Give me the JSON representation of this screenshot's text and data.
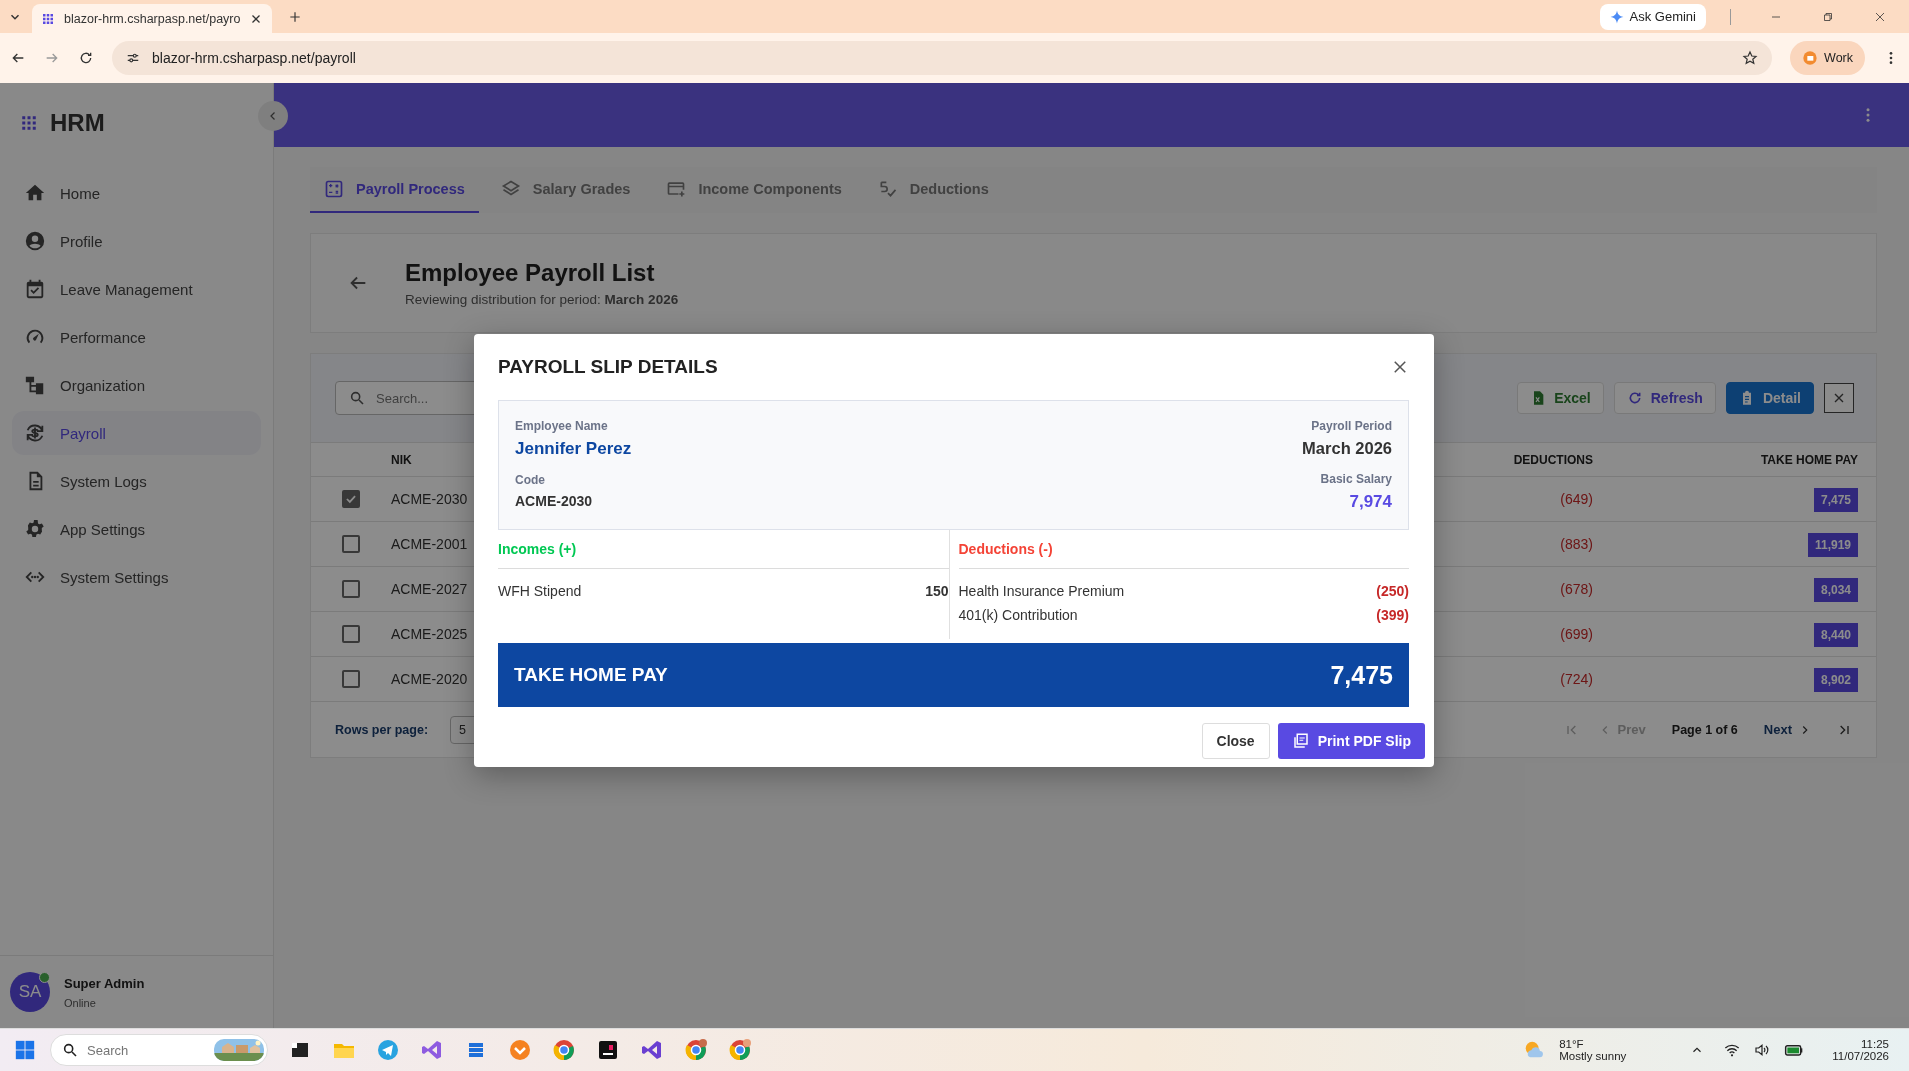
{
  "browser": {
    "tab_title": "blazor-hrm.csharpasp.net/payro",
    "url": "blazor-hrm.csharpasp.net/payroll",
    "gemini": "Ask Gemini",
    "profile": "Work"
  },
  "app": {
    "brand": "HRM"
  },
  "sidebar": {
    "items": [
      {
        "label": "Home",
        "selected": false
      },
      {
        "label": "Profile",
        "selected": false
      },
      {
        "label": "Leave Management",
        "selected": false
      },
      {
        "label": "Performance",
        "selected": false
      },
      {
        "label": "Organization",
        "selected": false
      },
      {
        "label": "Payroll",
        "selected": true
      },
      {
        "label": "System Logs",
        "selected": false
      },
      {
        "label": "App Settings",
        "selected": false
      },
      {
        "label": "System Settings",
        "selected": false
      }
    ],
    "user": {
      "initials": "SA",
      "name": "Super Admin",
      "status": "Online",
      "online": true
    }
  },
  "tabs": [
    {
      "label": "Payroll Process",
      "selected": true
    },
    {
      "label": "Salary Grades",
      "selected": false
    },
    {
      "label": "Income Components",
      "selected": false
    },
    {
      "label": "Deductions",
      "selected": false
    }
  ],
  "header": {
    "title": "Employee Payroll List",
    "subtitle": "Reviewing distribution for period: **March 2026**"
  },
  "toolbar": {
    "search": {
      "placeholder": "Search..."
    },
    "buttons": [
      {
        "label": "Excel",
        "kind": "excel"
      },
      {
        "label": "Refresh",
        "kind": "refresh"
      },
      {
        "label": "Detail",
        "kind": "detail"
      }
    ]
  },
  "table": {
    "columns": [
      "NIK",
      "DEDUCTIONS",
      "TAKE HOME PAY"
    ],
    "rows": [
      {
        "checked": true,
        "nik": "ACME-2030",
        "deductions": "(649)",
        "take_home_pay": "7,475"
      },
      {
        "checked": false,
        "nik": "ACME-2001",
        "deductions": "(883)",
        "take_home_pay": "11,919"
      },
      {
        "checked": false,
        "nik": "ACME-2027",
        "deductions": "(678)",
        "take_home_pay": "8,034"
      },
      {
        "checked": false,
        "nik": "ACME-2025",
        "deductions": "(699)",
        "take_home_pay": "8,440"
      },
      {
        "checked": false,
        "nik": "ACME-2020",
        "deductions": "(724)",
        "take_home_pay": "8,902"
      }
    ]
  },
  "pagination": {
    "rows_per_page_label": "Rows per page:",
    "rows_per_page": "5",
    "prev": "Prev",
    "page": "Page 1 of 6",
    "next": "Next"
  },
  "modal": {
    "title": "PAYROLL SLIP DETAILS",
    "employee_name_label": "Employee Name",
    "employee_name": "Jennifer Perez",
    "code_label": "Code",
    "code": "ACME-2030",
    "period_label": "Payroll Period",
    "period": "March 2026",
    "basic_salary_label": "Basic Salary",
    "basic_salary": "7,974",
    "incomes_title": "Incomes (+)",
    "incomes": [
      {
        "name": "WFH Stipend",
        "amount": "150"
      }
    ],
    "deductions_title": "Deductions (-)",
    "deductions": [
      {
        "name": "Health Insurance Premium",
        "amount": "(250)"
      },
      {
        "name": "401(k) Contribution",
        "amount": "(399)"
      }
    ],
    "take_home_label": "TAKE HOME PAY",
    "take_home": "7,475",
    "close_label": "Close",
    "print_label": "Print PDF Slip"
  },
  "taskbar": {
    "search_placeholder": "Search",
    "temperature": "81°F",
    "weather": "Mostly sunny",
    "time": "11:25",
    "date": "11/07/2026"
  }
}
